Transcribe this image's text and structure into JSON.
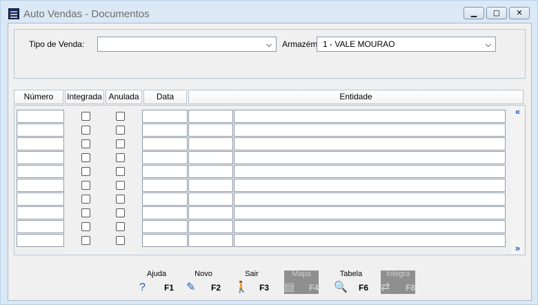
{
  "window": {
    "title": "Auto Vendas - Documentos",
    "min_icon": "minimize-icon",
    "max_icon": "maximize-icon",
    "close_icon": "close-icon"
  },
  "filters": {
    "tipo_venda_label": "Tipo de Venda:",
    "tipo_venda_value": "",
    "armazem_label": "Armazém:",
    "armazem_value": "1 - VALE MOURAO"
  },
  "table": {
    "headers": [
      "Número",
      "Integrada",
      "Anulada",
      "Data",
      "Entidade"
    ],
    "rows": 10,
    "scroll_up_icon": "double-chevron-left-icon",
    "scroll_down_icon": "double-chevron-right-icon"
  },
  "toolbar": [
    {
      "label": "Ajuda",
      "key": "F1",
      "icon": "help-icon",
      "enabled": true
    },
    {
      "label": "Novo",
      "key": "F2",
      "icon": "new-document-icon",
      "enabled": true
    },
    {
      "label": "Sair",
      "key": "F3",
      "icon": "exit-icon",
      "enabled": true
    },
    {
      "label": "Mapa",
      "key": "F4",
      "icon": "report-icon",
      "enabled": false
    },
    {
      "label": "Tabela",
      "key": "F6",
      "icon": "magnifier-icon",
      "enabled": true
    },
    {
      "label": "Integra",
      "key": "F8",
      "icon": "integrate-icon",
      "enabled": false
    }
  ],
  "colors": {
    "link_blue": "#1b5fbf",
    "disabled_gray": "#8f8f8f"
  }
}
